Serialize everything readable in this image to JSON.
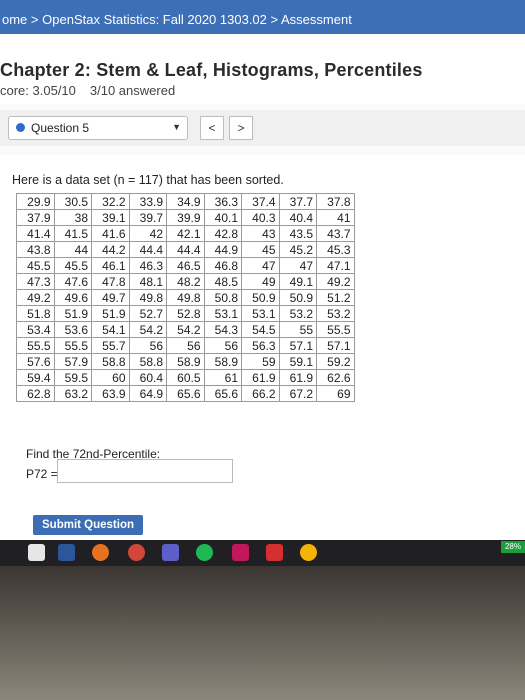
{
  "breadcrumb": {
    "home": "ome",
    "sep1": ">",
    "course": "OpenStax Statistics: Fall 2020 1303.02",
    "sep2": ">",
    "page": "Assessment"
  },
  "header": {
    "title": "Chapter 2: Stem & Leaf, Histograms, Percentiles",
    "score": "core: 3.05/10",
    "answered": "3/10 answered"
  },
  "question_nav": {
    "selected": "Question 5",
    "prev_label": "<",
    "next_label": ">"
  },
  "question": {
    "intro": "Here is a data set (n = 117) that has been sorted.",
    "rows": [
      [
        "29.9",
        "30.5",
        "32.2",
        "33.9",
        "34.9",
        "36.3",
        "37.4",
        "37.7",
        "37.8"
      ],
      [
        "37.9",
        "38",
        "39.1",
        "39.7",
        "39.9",
        "40.1",
        "40.3",
        "40.4",
        "41"
      ],
      [
        "41.4",
        "41.5",
        "41.6",
        "42",
        "42.1",
        "42.8",
        "43",
        "43.5",
        "43.7"
      ],
      [
        "43.8",
        "44",
        "44.2",
        "44.4",
        "44.4",
        "44.9",
        "45",
        "45.2",
        "45.3"
      ],
      [
        "45.5",
        "45.5",
        "46.1",
        "46.3",
        "46.5",
        "46.8",
        "47",
        "47",
        "47.1"
      ],
      [
        "47.3",
        "47.6",
        "47.8",
        "48.1",
        "48.2",
        "48.5",
        "49",
        "49.1",
        "49.2"
      ],
      [
        "49.2",
        "49.6",
        "49.7",
        "49.8",
        "49.8",
        "50.8",
        "50.9",
        "50.9",
        "51.2"
      ],
      [
        "51.8",
        "51.9",
        "51.9",
        "52.7",
        "52.8",
        "53.1",
        "53.1",
        "53.2",
        "53.2"
      ],
      [
        "53.4",
        "53.6",
        "54.1",
        "54.2",
        "54.2",
        "54.3",
        "54.5",
        "55",
        "55.5"
      ],
      [
        "55.5",
        "55.5",
        "55.7",
        "56",
        "56",
        "56",
        "56.3",
        "57.1",
        "57.1"
      ],
      [
        "57.6",
        "57.9",
        "58.8",
        "58.8",
        "58.9",
        "58.9",
        "59",
        "59.1",
        "59.2"
      ],
      [
        "59.4",
        "59.5",
        "60",
        "60.4",
        "60.5",
        "61",
        "61.9",
        "61.9",
        "62.6"
      ],
      [
        "62.8",
        "63.2",
        "63.9",
        "64.9",
        "65.6",
        "65.6",
        "66.2",
        "67.2",
        "69"
      ]
    ],
    "find_label": "Find the 72nd-Percentile:",
    "p_label": "P72 =",
    "answer_value": "",
    "submit_label": "Submit Question"
  },
  "taskbar": {
    "battery": "28%",
    "icons": [
      "shield-icon",
      "word-icon",
      "firefox-icon",
      "chrome-icon",
      "teams-icon",
      "spotify-icon",
      "app-icon",
      "acrobat-icon",
      "chrome-alt-icon"
    ]
  },
  "colors": {
    "brand_blue": "#3d6fb6",
    "accent_blue": "#2d6bd1",
    "taskbar": "#1f1f24"
  }
}
